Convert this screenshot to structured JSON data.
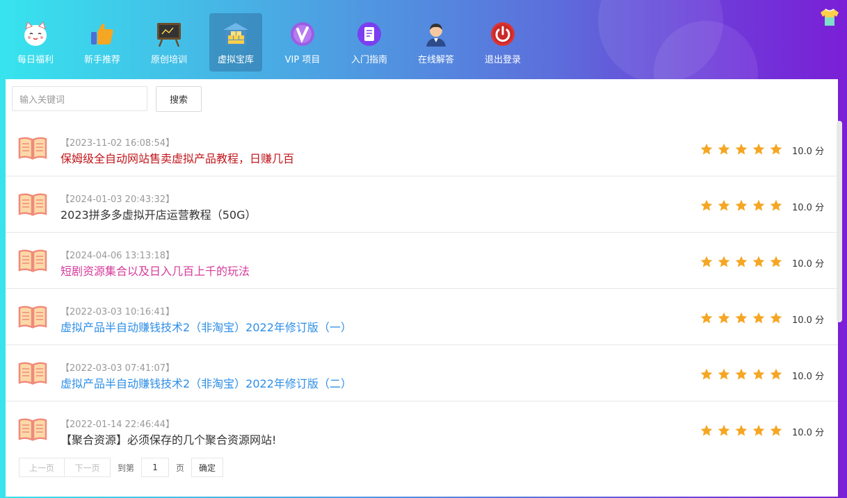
{
  "nav": {
    "items": [
      {
        "label": "每日福利",
        "icon": "lucky-cat-icon"
      },
      {
        "label": "新手推荐",
        "icon": "thumbs-up-icon"
      },
      {
        "label": "原创培训",
        "icon": "blackboard-icon"
      },
      {
        "label": "虚拟宝库",
        "icon": "treasure-house-icon",
        "active": true
      },
      {
        "label": "VIP 项目",
        "icon": "vip-icon"
      },
      {
        "label": "入门指南",
        "icon": "guide-doc-icon"
      },
      {
        "label": "在线解答",
        "icon": "support-agent-icon"
      },
      {
        "label": "退出登录",
        "icon": "power-icon"
      }
    ]
  },
  "search": {
    "placeholder": "输入关键词",
    "button": "搜索"
  },
  "list": [
    {
      "date": "【2023-11-02 16:08:54】",
      "title": "保姆级全自动网站售卖虚拟产品教程，日赚几百",
      "color": "#c0161c",
      "rating": 5,
      "score": "10.0 分"
    },
    {
      "date": "【2024-01-03 20:43:32】",
      "title": "2023拼多多虚拟开店运营教程（50G）",
      "color": "#333333",
      "rating": 5,
      "score": "10.0 分"
    },
    {
      "date": "【2024-04-06 13:13:18】",
      "title": "短剧资源集合以及日入几百上千的玩法",
      "color": "#d63b9a",
      "rating": 5,
      "score": "10.0 分"
    },
    {
      "date": "【2022-03-03 10:16:41】",
      "title": "虚拟产品半自动赚钱技术2（非淘宝）2022年修订版（一）",
      "color": "#2d8ee6",
      "rating": 5,
      "score": "10.0 分"
    },
    {
      "date": "【2022-03-03 07:41:07】",
      "title": "虚拟产品半自动赚钱技术2（非淘宝）2022年修订版（二）",
      "color": "#2d8ee6",
      "rating": 5,
      "score": "10.0 分"
    },
    {
      "date": "【2022-01-14 22:46:44】",
      "title": "【聚合资源】必须保存的几个聚合资源网站!",
      "color": "#333333",
      "rating": 5,
      "score": "10.0 分"
    }
  ],
  "pager": {
    "prev": "上一页",
    "next": "下一页",
    "goto": "到第",
    "page": "1",
    "unit": "页",
    "confirm": "确定"
  },
  "colors": {
    "star": "#f5a623",
    "book": "#f08a7a"
  }
}
